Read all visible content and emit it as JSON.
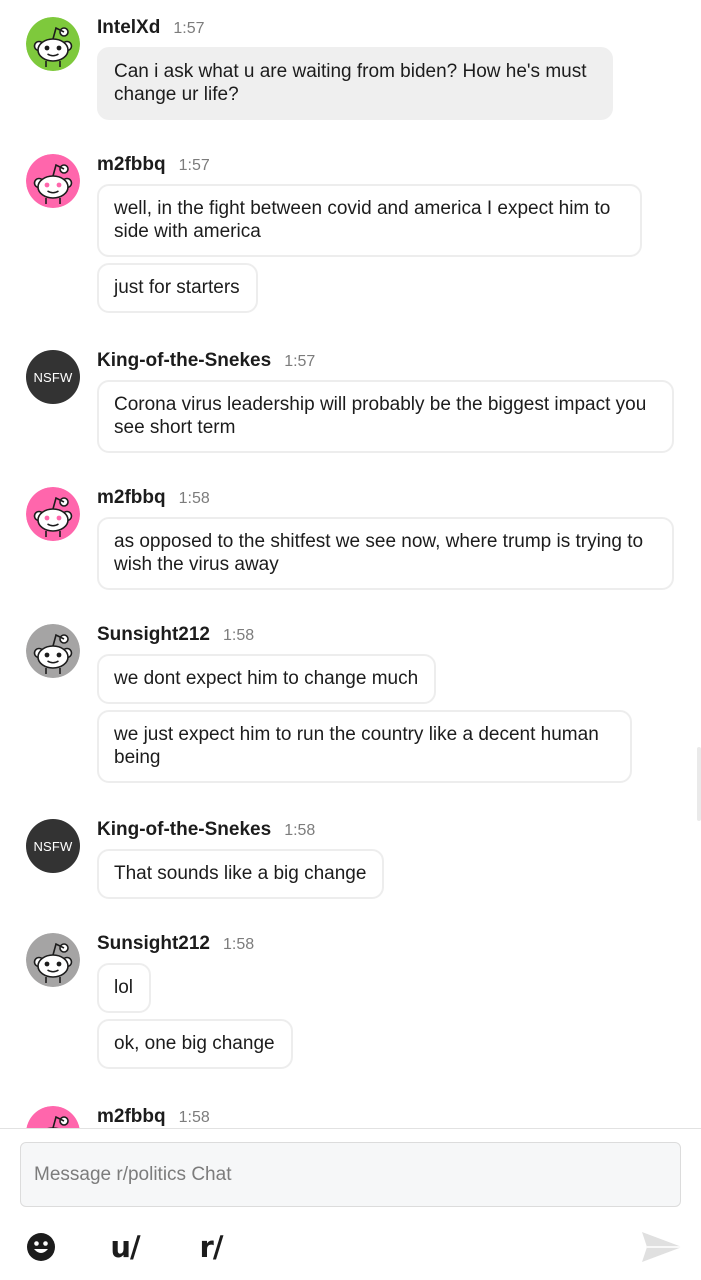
{
  "chat": {
    "messages": [
      {
        "user": "IntelXd",
        "time": "1:57",
        "avatar": {
          "kind": "snoo",
          "bg": "#7ec93c"
        },
        "bubbles": [
          {
            "text": "Can i ask what u are waiting from biden? How he's must change ur life?",
            "style": "grey"
          }
        ]
      },
      {
        "user": "m2fbbq",
        "time": "1:57",
        "avatar": {
          "kind": "snoo",
          "bg": "#ff66ac"
        },
        "bubbles": [
          {
            "text": "well, in the fight between covid and america I expect him to side with america",
            "style": "outline"
          },
          {
            "text": "just for starters",
            "style": "outline"
          }
        ]
      },
      {
        "user": "King-of-the-Snekes",
        "time": "1:57",
        "avatar": {
          "kind": "nsfw",
          "label": "NSFW"
        },
        "bubbles": [
          {
            "text": "Corona virus leadership will probably be the biggest impact you see short term",
            "style": "outline"
          }
        ]
      },
      {
        "user": "m2fbbq",
        "time": "1:58",
        "avatar": {
          "kind": "snoo",
          "bg": "#ff66ac"
        },
        "bubbles": [
          {
            "text": "as opposed to the shitfest we see now, where trump is trying to wish the virus away",
            "style": "outline"
          }
        ]
      },
      {
        "user": "Sunsight212",
        "time": "1:58",
        "avatar": {
          "kind": "snoo",
          "bg": "#a5a4a4"
        },
        "bubbles": [
          {
            "text": "we dont expect him to change much",
            "style": "outline"
          },
          {
            "text": "we just expect him to run the country like a decent human being",
            "style": "outline"
          }
        ]
      },
      {
        "user": "King-of-the-Snekes",
        "time": "1:58",
        "avatar": {
          "kind": "nsfw",
          "label": "NSFW"
        },
        "bubbles": [
          {
            "text": "That sounds like a big change",
            "style": "outline"
          }
        ]
      },
      {
        "user": "Sunsight212",
        "time": "1:58",
        "avatar": {
          "kind": "snoo",
          "bg": "#a5a4a4"
        },
        "bubbles": [
          {
            "text": "lol",
            "style": "outline"
          },
          {
            "text": "ok, one big change",
            "style": "outline"
          }
        ]
      },
      {
        "user": "m2fbbq",
        "time": "1:58",
        "avatar": {
          "kind": "snoo",
          "bg": "#ff66ac"
        },
        "bubbles": []
      }
    ]
  },
  "composer": {
    "placeholder": "Message r/politics Chat",
    "value": ""
  },
  "toolbar": {
    "emoji_icon": "smiley-icon",
    "user_mention_label": "u/",
    "subreddit_mention_label": "r/",
    "send_icon": "paper-plane-icon"
  },
  "colors": {
    "grey_bubble": "#efefef",
    "bubble_border": "#ededed",
    "timestamp": "#7c7c7c",
    "send_disabled": "#e0e0e0"
  }
}
